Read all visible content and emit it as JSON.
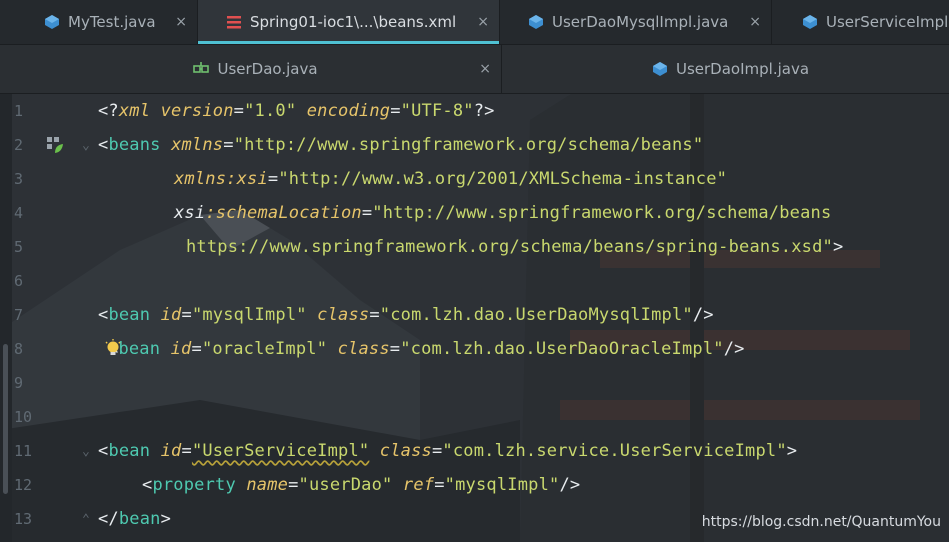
{
  "tabs_row1": [
    {
      "label": "MyTest.java",
      "icon": "java-class-icon",
      "active": false
    },
    {
      "label": "Spring01-ioc1\\...\\beans.xml",
      "icon": "spring-xml-icon",
      "active": true
    },
    {
      "label": "UserDaoMysqlImpl.java",
      "icon": "java-class-icon",
      "active": false
    },
    {
      "label": "UserServiceImpl.",
      "icon": "java-class-icon",
      "active": false
    }
  ],
  "tabs_row2": [
    {
      "label": "UserDao.java",
      "icon": "java-interface-icon",
      "active": false
    },
    {
      "label": "UserDaoImpl.java",
      "icon": "java-class-icon",
      "active": false
    }
  ],
  "close_glyph": "×",
  "line_numbers": [
    "1",
    "2",
    "3",
    "4",
    "5",
    "6",
    "7",
    "8",
    "9",
    "10",
    "11",
    "12",
    "13"
  ],
  "code": {
    "l1": {
      "lt": "<?",
      "decl": "xml",
      "a1": "version",
      "eq": "=",
      "v1": "\"1.0\"",
      "a2": "encoding",
      "v2": "\"UTF-8\"",
      "end": "?>"
    },
    "l2": {
      "lt": "<",
      "tag": "beans",
      "attr": "xmlns",
      "eq": "=",
      "val": "\"http://www.springframework.org/schema/beans\""
    },
    "l3": {
      "attr": "xmlns:xsi",
      "eq": "=",
      "val": "\"http://www.w3.org/2001/XMLSchema-instance\""
    },
    "l4": {
      "prefix": "xsi",
      "attr": ":schemaLocation",
      "eq": "=",
      "val": "\"http://www.springframework.org/schema/beans"
    },
    "l5": {
      "val": "https://www.springframework.org/schema/beans/spring-beans.xsd\"",
      "end": ">"
    },
    "l7": {
      "lt": "<",
      "tag": "bean",
      "a1": "id",
      "v1": "\"mysqlImpl\"",
      "a2": "class",
      "v2": "\"com.lzh.dao.UserDaoMysqlImpl\"",
      "end": "/>"
    },
    "l8": {
      "lt": "<",
      "tag": "bean",
      "a1": "id",
      "v1": "\"oracleImpl\"",
      "a2": "class",
      "v2": "\"com.lzh.dao.UserDaoOracleImpl\"",
      "end": "/>"
    },
    "l11": {
      "lt": "<",
      "tag": "bean",
      "a1": "id",
      "v1": "\"UserServiceImpl\"",
      "a2": "class",
      "v2": "\"com.lzh.service.UserServiceImpl\"",
      "end": ">"
    },
    "l12": {
      "lt": "<",
      "tag": "property",
      "a1": "name",
      "v1": "\"userDao\"",
      "a2": "ref",
      "v2": "\"mysqlImpl\"",
      "end": "/>"
    },
    "l13": {
      "lt": "</",
      "tag": "bean",
      "end": ">"
    }
  },
  "watermark": "https://blog.csdn.net/QuantumYou",
  "colors": {
    "accent": "#4fc1d3",
    "tag": "#4ec9b0",
    "attribute": "#e6c46a",
    "string": "#c9d86e"
  }
}
